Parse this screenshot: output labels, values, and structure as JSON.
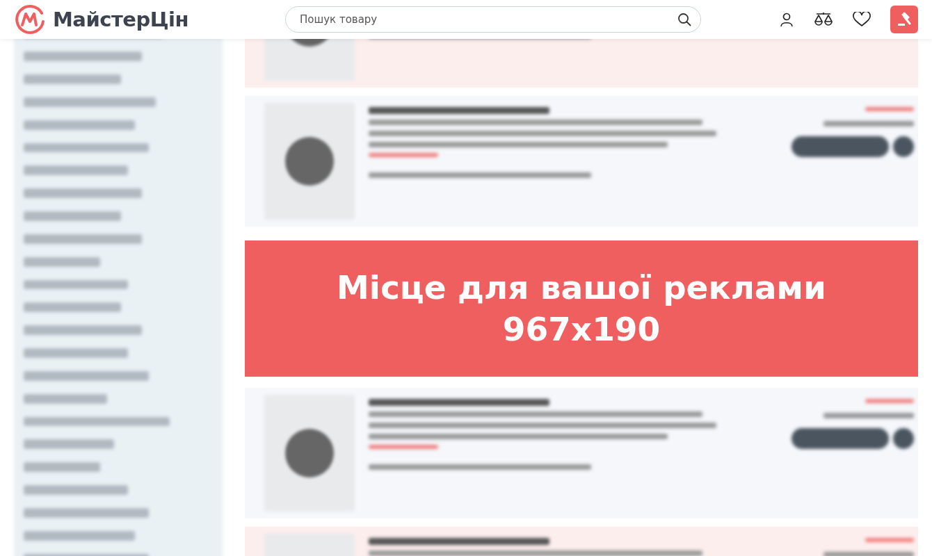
{
  "header": {
    "logo": "МайстерЦін",
    "search": {
      "placeholder": "Пошук товару"
    }
  },
  "content": [
    {
      "kind": "product",
      "highlighted": true
    },
    {
      "kind": "product",
      "highlighted": false
    },
    {
      "kind": "ad",
      "lines": [
        "Місце для вашої реклами",
        "967x190"
      ]
    },
    {
      "kind": "product",
      "highlighted": false
    },
    {
      "kind": "product",
      "highlighted": true
    }
  ]
}
